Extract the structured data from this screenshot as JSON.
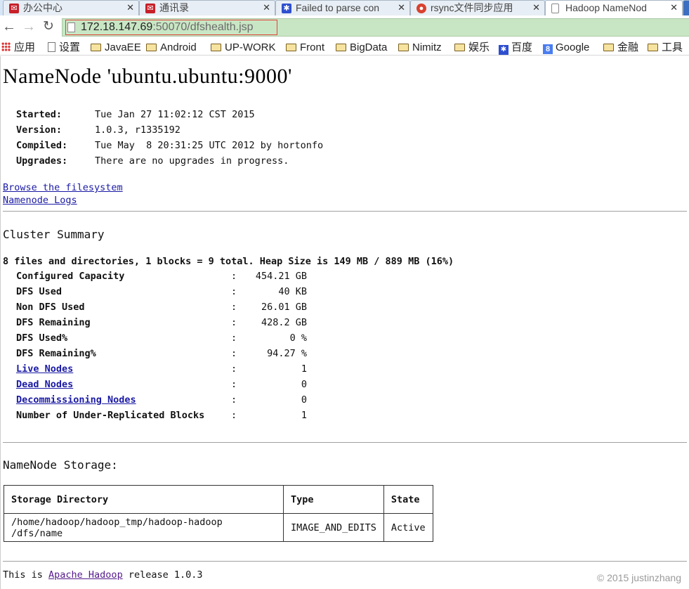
{
  "browser": {
    "tabs": [
      {
        "title": "办公中心",
        "icon": "envelope-icon",
        "active": false
      },
      {
        "title": "通讯录",
        "icon": "envelope-icon",
        "active": false
      },
      {
        "title": "Failed to parse con",
        "icon": "paw-icon",
        "active": false
      },
      {
        "title": "rsync文件同步应用",
        "icon": "chrome-icon",
        "active": false
      },
      {
        "title": "Hadoop NameNod",
        "icon": "page-icon",
        "active": true
      }
    ],
    "url_host": "172.18.147.69",
    "url_rest": ":50070/dfshealth.jsp",
    "bookmarks": [
      {
        "label": "应用",
        "icon": "apps-grid-icon"
      },
      {
        "label": "设置",
        "icon": "page-icon"
      },
      {
        "label": "JavaEE",
        "icon": "folder-icon"
      },
      {
        "label": "Android",
        "icon": "folder-icon"
      },
      {
        "label": "UP-WORK",
        "icon": "folder-icon"
      },
      {
        "label": "Front",
        "icon": "folder-icon"
      },
      {
        "label": "BigData",
        "icon": "folder-icon"
      },
      {
        "label": "Nimitz",
        "icon": "folder-icon"
      },
      {
        "label": "娱乐",
        "icon": "folder-icon"
      },
      {
        "label": "百度",
        "icon": "baidu-icon"
      },
      {
        "label": "Google",
        "icon": "google-icon"
      },
      {
        "label": "金融",
        "icon": "folder-icon"
      },
      {
        "label": "工具",
        "icon": "folder-icon"
      }
    ]
  },
  "page": {
    "title": "NameNode 'ubuntu.ubuntu:9000'",
    "info": [
      {
        "label": "Started:",
        "value": "Tue Jan 27 11:02:12 CST 2015"
      },
      {
        "label": "Version:",
        "value": "1.0.3, r1335192"
      },
      {
        "label": "Compiled:",
        "value": "Tue May  8 20:31:25 UTC 2012 by hortonfo"
      },
      {
        "label": "Upgrades:",
        "value": "There are no upgrades in progress."
      }
    ],
    "links": {
      "browse": "Browse the filesystem",
      "logs": "Namenode Logs"
    },
    "cluster_summary": {
      "heading": "Cluster Summary",
      "summary_line": "8 files and directories, 1 blocks = 9 total. Heap Size is 149 MB / 889 MB (16%)",
      "stats": [
        {
          "label": "Configured Capacity",
          "value": "454.21 GB",
          "link": false
        },
        {
          "label": "DFS Used",
          "value": "40 KB",
          "link": false
        },
        {
          "label": "Non DFS Used",
          "value": "26.01 GB",
          "link": false
        },
        {
          "label": "DFS Remaining",
          "value": "428.2 GB",
          "link": false
        },
        {
          "label": "DFS Used%",
          "value": "0 %",
          "link": false
        },
        {
          "label": "DFS Remaining%",
          "value": "94.27 %",
          "link": false
        },
        {
          "label": "Live Nodes",
          "value": "1",
          "link": true
        },
        {
          "label": "Dead Nodes",
          "value": "0",
          "link": true
        },
        {
          "label": "Decommissioning Nodes",
          "value": "0",
          "link": true
        },
        {
          "label": "Number of Under-Replicated Blocks",
          "value": "1",
          "link": false
        }
      ],
      "colon": ":"
    },
    "storage": {
      "heading": "NameNode Storage:",
      "headers": [
        "Storage Directory",
        "Type",
        "State"
      ],
      "rows": [
        [
          "/home/hadoop/hadoop_tmp/hadoop-hadoop /dfs/name",
          "IMAGE_AND_EDITS",
          "Active"
        ]
      ]
    },
    "footer": {
      "prefix": "This is ",
      "link": "Apache Hadoop",
      "suffix": " release 1.0.3"
    },
    "watermark": "© 2015 justinzhang"
  }
}
